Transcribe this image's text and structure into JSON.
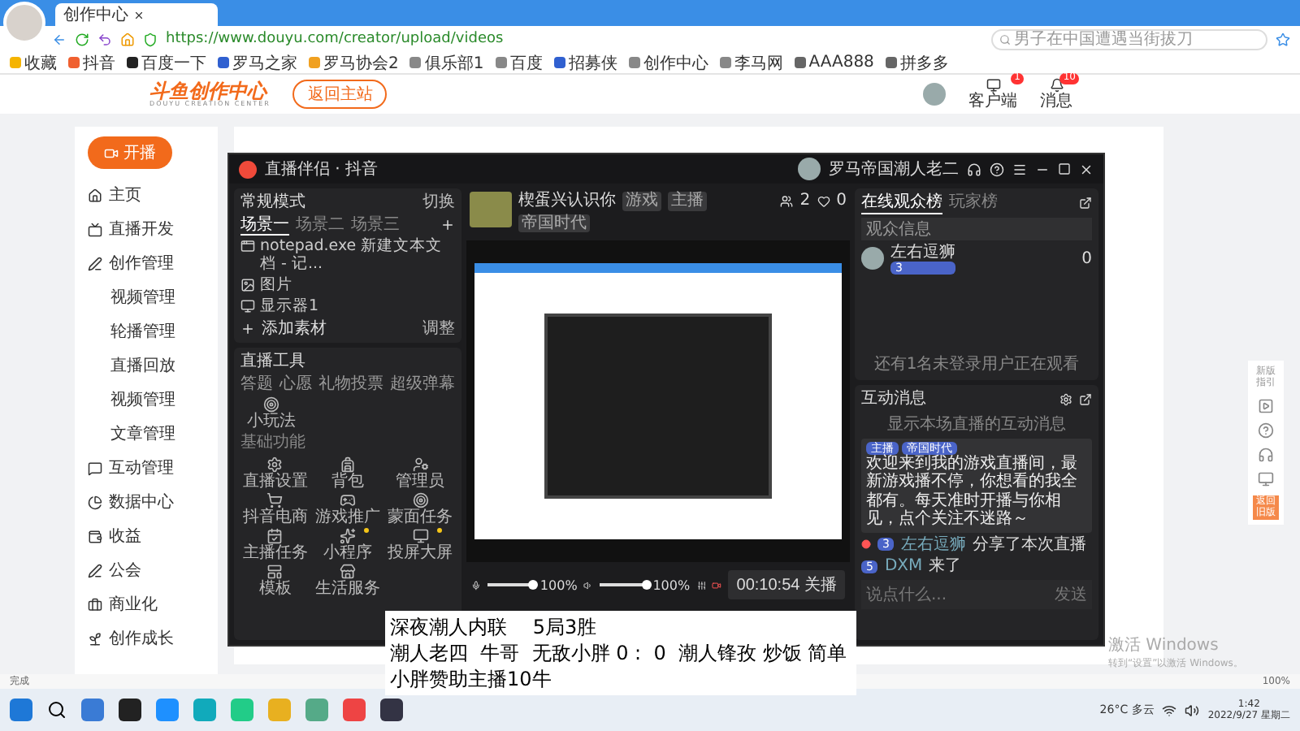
{
  "browser": {
    "tab_title": "创作中心",
    "url": "https://www.douyu.com/creator/upload/videos",
    "search_placeholder": "男子在中国遭遇当街拔刀",
    "bookmarks": [
      "收藏",
      "抖音",
      "百度一下",
      "罗马之家",
      "罗马协会2",
      "俱乐部1",
      "百度",
      "招募侠",
      "创作中心",
      "李马网",
      "AAA888",
      "拼多多"
    ]
  },
  "header": {
    "logo": "斗鱼创作中心",
    "logo_sub": "DOUYU CREATION CENTER",
    "back": "返回主站",
    "actions": [
      {
        "kind": "client",
        "label": "客户端",
        "badge": "1"
      },
      {
        "kind": "message",
        "label": "消息",
        "badge": "10"
      }
    ]
  },
  "sidebar": {
    "start": "开播",
    "items": [
      {
        "label": "主页",
        "kind": "home"
      },
      {
        "label": "直播开发",
        "kind": "live"
      },
      {
        "label": "创作管理",
        "kind": "create",
        "children": [
          {
            "label": "视频管理"
          },
          {
            "label": "轮播管理"
          },
          {
            "label": "直播回放"
          },
          {
            "label": "视频管理"
          },
          {
            "label": "文章管理"
          }
        ]
      },
      {
        "label": "互动管理",
        "kind": "chat"
      },
      {
        "label": "数据中心",
        "kind": "data"
      },
      {
        "label": "收益",
        "kind": "income"
      },
      {
        "label": "公会",
        "kind": "guild"
      },
      {
        "label": "商业化",
        "kind": "biz"
      },
      {
        "label": "创作成长",
        "kind": "grow"
      }
    ]
  },
  "right_toolbar": [
    {
      "kind": "text",
      "label": "新版指引"
    },
    {
      "kind": "video"
    },
    {
      "kind": "help"
    },
    {
      "kind": "service"
    },
    {
      "kind": "screen"
    },
    {
      "kind": "highlight",
      "label": "返回旧版"
    }
  ],
  "app": {
    "title": "直播伴侣 · 抖音",
    "user": "罗马帝国潮人老二",
    "mode": "常规模式",
    "switch": "切换",
    "scenes": [
      {
        "label": "场景一",
        "selected": true
      },
      {
        "label": "场景二",
        "selected": false
      },
      {
        "label": "场景三",
        "selected": false
      }
    ],
    "sources": [
      {
        "kind": "window",
        "label": "notepad.exe 新建文本文档 - 记..."
      },
      {
        "kind": "image",
        "label": "图片"
      },
      {
        "kind": "display",
        "label": "显示器1"
      }
    ],
    "add_source": "添加素材",
    "adjust": "调整",
    "tools_title": "直播工具",
    "tools": [
      "答题",
      "心愿",
      "礼物投票",
      "超级弹幕"
    ],
    "mini_game": "小玩法",
    "basic_title": "基础功能",
    "basic_tools": [
      {
        "kind": "settings",
        "label": "直播设置",
        "dot": false
      },
      {
        "kind": "bag",
        "label": "背包",
        "dot": false
      },
      {
        "kind": "admin",
        "label": "管理员",
        "dot": false
      },
      {
        "kind": "shop",
        "label": "抖音电商",
        "dot": false
      },
      {
        "kind": "game",
        "label": "游戏推广",
        "dot": false
      },
      {
        "kind": "task",
        "label": "蒙面任务",
        "dot": false
      },
      {
        "kind": "check",
        "label": "主播任务",
        "dot": false
      },
      {
        "kind": "spark",
        "label": "小程序",
        "dot": true
      },
      {
        "kind": "screen",
        "label": "投屏大屏",
        "dot": true
      },
      {
        "kind": "layout",
        "label": "模板",
        "dot": false
      },
      {
        "kind": "store",
        "label": "生活服务",
        "dot": false
      }
    ],
    "stream": {
      "title": "楔蛋兴认识你",
      "tags": [
        "游戏",
        "主播"
      ],
      "category": "帝国时代",
      "viewers": "2",
      "likes": "0"
    },
    "mic": {
      "level": 1,
      "reading": "100%"
    },
    "speaker": {
      "level": 1,
      "reading": "100%"
    },
    "timer": "00:10:54",
    "end": "关播",
    "audience_tabs": [
      {
        "label": "在线观众榜",
        "selected": true
      },
      {
        "label": "玩家榜",
        "selected": false
      }
    ],
    "audience_header": "观众信息",
    "viewers": [
      {
        "name": "左右逗狮",
        "badge": "3",
        "score": "0"
      }
    ],
    "audience_note": "还有1名未登录用户正在观看",
    "chat_title": "互动消息",
    "chat_hint": "显示本场直播的互动消息",
    "welcome_tags": [
      "主播",
      "帝国时代"
    ],
    "welcome": "欢迎来到我的游戏直播间，最新游戏播不停，你想看的我全都有。每天准时开播与你相见，点个关注不迷路～",
    "events": [
      {
        "badge": "3",
        "name": "左右逗狮",
        "text": "分享了本次直播",
        "dot": true
      },
      {
        "badge": "5",
        "name": "DXM",
        "text": "来了",
        "dot": false
      }
    ],
    "chat_placeholder": "说点什么...",
    "send": "发送"
  },
  "subtitle": [
    "深夜潮人内联　 5局3胜",
    "潮人老四  牛哥  无敌小胖 0 :  0  潮人锋孜 炒饭 简单",
    "小胖赞助主播10牛"
  ],
  "status_bar": {
    "text": "完成",
    "zoom": "100%"
  },
  "activation": {
    "title": "激活 Windows",
    "text": "转到“设置”以激活 Windows。"
  },
  "taskbar": {
    "weather": "26°C 多云",
    "time": "1:42",
    "date": "2022/9/27 星期二"
  }
}
